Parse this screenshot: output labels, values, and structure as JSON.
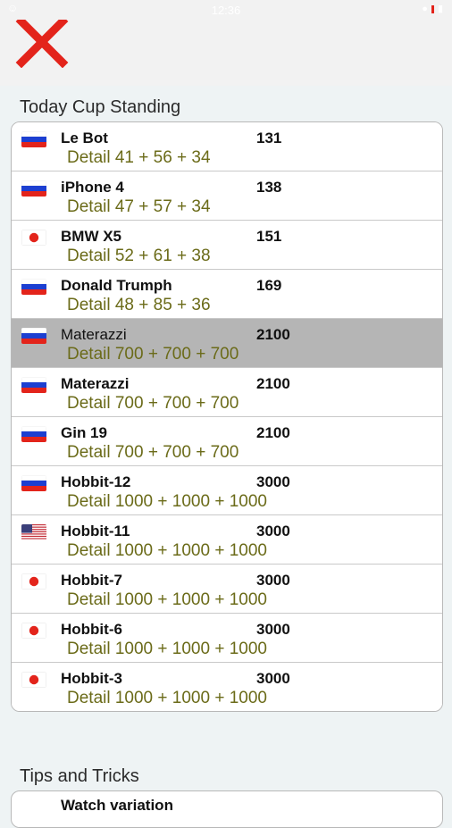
{
  "status": {
    "time": "12:36",
    "wifi": "wifi",
    "battery": "battery"
  },
  "header": {
    "close_icon": "close-x-icon",
    "close_color": "#e3241b"
  },
  "standing": {
    "title": "Today Cup Standing",
    "rows": [
      {
        "flag": "ru",
        "name": "Le Bot",
        "score": "131",
        "detail": "Detail 41 + 56 + 34",
        "selected": false
      },
      {
        "flag": "ru",
        "name": "iPhone 4",
        "score": "138",
        "detail": "Detail 47 + 57 + 34",
        "selected": false
      },
      {
        "flag": "jp",
        "name": "BMW X5",
        "score": "151",
        "detail": "Detail 52 + 61 + 38",
        "selected": false
      },
      {
        "flag": "ru",
        "name": "Donald Trumph",
        "score": "169",
        "detail": "Detail 48 + 85 + 36",
        "selected": false
      },
      {
        "flag": "ru",
        "name": "Materazzi",
        "score": "2100",
        "detail": "Detail 700 + 700 + 700",
        "selected": true
      },
      {
        "flag": "ru",
        "name": "Materazzi",
        "score": "2100",
        "detail": "Detail 700 + 700 + 700",
        "selected": false
      },
      {
        "flag": "ru",
        "name": "Gin 19",
        "score": "2100",
        "detail": "Detail 700 + 700 + 700",
        "selected": false
      },
      {
        "flag": "ru",
        "name": "Hobbit-12",
        "score": "3000",
        "detail": "Detail 1000 + 1000 + 1000",
        "selected": false
      },
      {
        "flag": "us",
        "name": "Hobbit-11",
        "score": "3000",
        "detail": "Detail 1000 + 1000 + 1000",
        "selected": false
      },
      {
        "flag": "jp",
        "name": "Hobbit-7",
        "score": "3000",
        "detail": "Detail 1000 + 1000 + 1000",
        "selected": false
      },
      {
        "flag": "jp",
        "name": "Hobbit-6",
        "score": "3000",
        "detail": "Detail 1000 + 1000 + 1000",
        "selected": false
      },
      {
        "flag": "jp",
        "name": "Hobbit-3",
        "score": "3000",
        "detail": "Detail 1000 + 1000 + 1000",
        "selected": false
      }
    ]
  },
  "tips": {
    "title": "Tips and Tricks",
    "rows": [
      {
        "name": "Watch variation"
      }
    ]
  }
}
